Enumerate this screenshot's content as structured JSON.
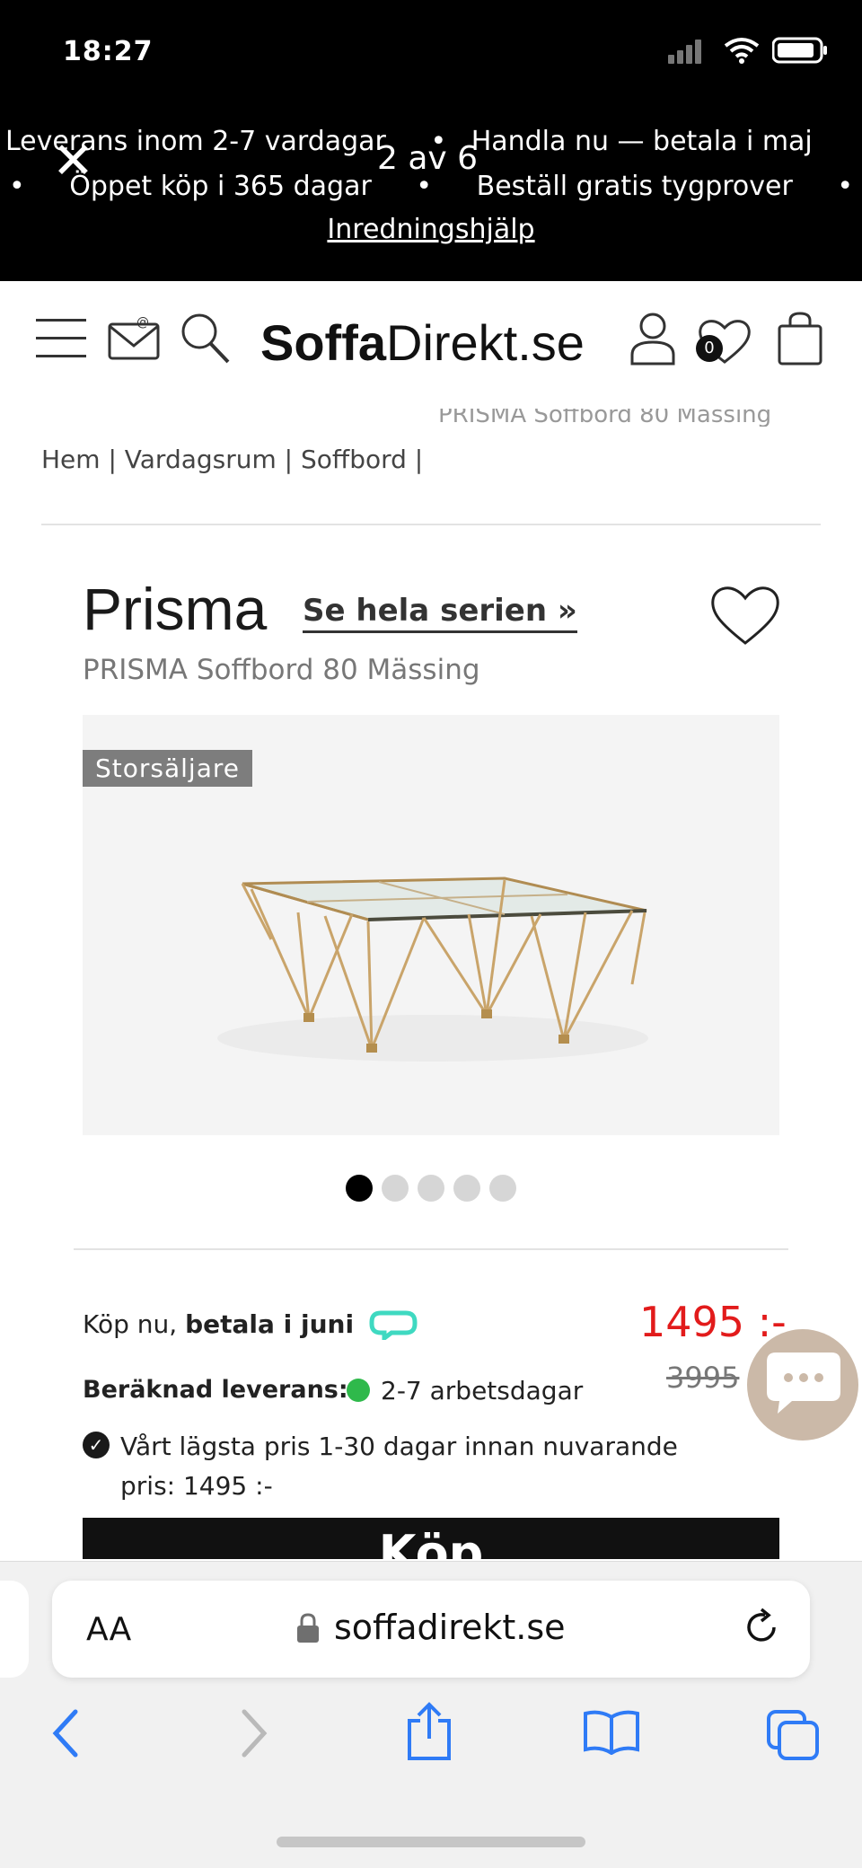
{
  "status_bar": {
    "time": "18:27"
  },
  "promo": {
    "line1": [
      "Leverans inom 2-7 vardagar",
      "•",
      "Handla nu — betala i maj"
    ],
    "line2": [
      "•",
      "Öppet köp i 365 dagar",
      "•",
      "Beställ gratis tygprover",
      "•"
    ],
    "link": "Inredningshjälp",
    "story_close": "✕",
    "story_counter": "2 av 6"
  },
  "header": {
    "logo_bold": "Soffa",
    "logo_light": "Direkt.se",
    "cart_count": "0"
  },
  "breadcrumb": "Hem | Vardagsrum | Soffbord |",
  "product": {
    "title": "Prisma",
    "series_link": "Se hela serien »",
    "subtitle": "PRISMA Soffbord 80 Mässing",
    "badge": "Storsäljare",
    "carousel_total": 5,
    "carousel_active": 0,
    "pay_now_prefix": "Köp nu,",
    "pay_now_bold": "betala i juni",
    "price": "1495 :-",
    "old_price": "3995",
    "delivery_label": "Beräknad leverans:",
    "delivery_value": "2-7 arbetsdagar",
    "lowest_line1": "Vårt lägsta pris 1-30 dagar innan nuvarande",
    "lowest_line2": "pris: 1495 :-",
    "buy_label": "Köp"
  },
  "browser": {
    "text_size": "AA",
    "url": "soffadirekt.se"
  },
  "colors": {
    "price_red": "#e21b1b",
    "delivery_green": "#2fb94b",
    "klarna_teal": "#3fd9c1",
    "ios_blue": "#2f7bf6",
    "chat_beige": "#cbb9a8"
  }
}
